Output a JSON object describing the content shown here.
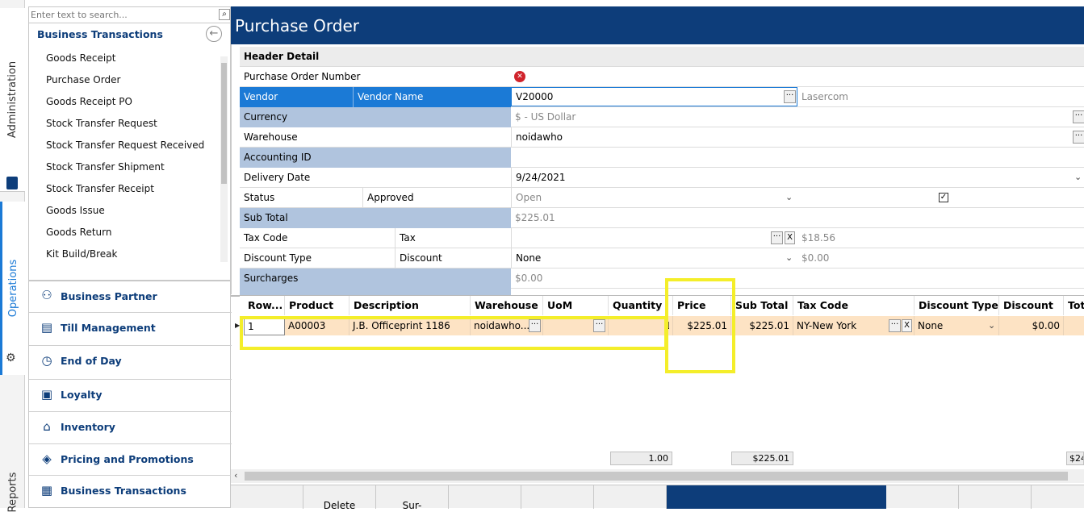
{
  "vertical_tabs": {
    "administration": "Administration",
    "operations": "Operations",
    "reports": "Reports"
  },
  "nav": {
    "search_placeholder": "Enter text to search...",
    "header": "Business Transactions",
    "items": [
      "Goods Receipt",
      "Purchase Order",
      "Goods Receipt PO",
      "Stock Transfer Request",
      "Stock Transfer Request Received",
      "Stock Transfer Shipment",
      "Stock Transfer Receipt",
      "Goods Issue",
      "Goods Return",
      "Kit Build/Break"
    ],
    "sections": [
      "Business Partner",
      "Till Management",
      "End of Day",
      "Loyalty",
      "Inventory",
      "Pricing and Promotions",
      "Business Transactions"
    ]
  },
  "page_title": "Purchase Order",
  "header_detail": {
    "title": "Header Detail",
    "po_number_label": "Purchase Order Number",
    "vendor_label": "Vendor",
    "vendor_name_label": "Vendor Name",
    "vendor_value": "V20000",
    "vendor_name_value": "Lasercom",
    "currency_label": "Currency",
    "currency_value": "$ - US Dollar",
    "warehouse_label": "Warehouse",
    "warehouse_value": "noidawho",
    "accounting_id_label": "Accounting ID",
    "delivery_date_label": "Delivery Date",
    "delivery_date_value": "9/24/2021",
    "status_label": "Status",
    "approved_label": "Approved",
    "status_value": "Open",
    "subtotal_label": "Sub Total",
    "subtotal_value": "$225.01",
    "tax_code_label": "Tax Code",
    "tax_label": "Tax",
    "tax_value": "$18.56",
    "discount_type_label": "Discount Type",
    "discount_label": "Discount",
    "discount_type_value": "None",
    "discount_value": "$0.00",
    "surcharges_label": "Surcharges",
    "surcharges_value": "$0.00"
  },
  "grid": {
    "headers": [
      "Row...",
      "Product",
      "Description",
      "Warehouse",
      "UoM",
      "Quantity",
      "Price",
      "Sub Total",
      "Tax Code",
      "Discount Type",
      "Discount",
      "Tot"
    ],
    "row": {
      "row": "1",
      "product": "A00003",
      "description": "J.B. Officeprint 1186",
      "warehouse": "noidawho...",
      "uom": "",
      "quantity": "1",
      "price": "$225.01",
      "subtotal": "$225.01",
      "tax_code": "NY-New York",
      "discount_type": "None",
      "discount": "$0.00",
      "tot": ""
    },
    "totals": {
      "quantity": "1.00",
      "subtotal": "$225.01",
      "tot": "$24"
    }
  },
  "bottom_buttons": [
    "",
    "Delete",
    "Sur-",
    "",
    "",
    "",
    "",
    "",
    "",
    ""
  ],
  "colors": {
    "brand": "#0d3d7a",
    "selected": "#1b7ad6",
    "shade": "#b0c4de",
    "row_highlight": "#fde3c4",
    "annotation": "#f4ee2a"
  }
}
